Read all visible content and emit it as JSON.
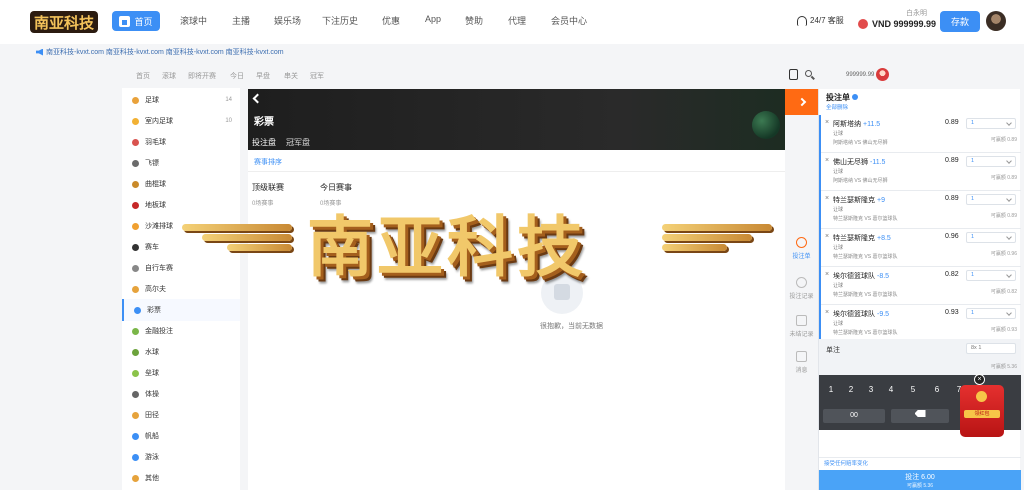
{
  "header": {
    "home_label": "首页",
    "nav": [
      "滚球中",
      "主播",
      "娱乐场",
      "下注历史",
      "优惠",
      "App",
      "赞助",
      "代理",
      "会员中心"
    ],
    "service_label": "24/7 客服",
    "account_name": "白永明",
    "balance": "VND 999999.99",
    "deposit_label": "存款"
  },
  "marquee": "南亚科技-kvxt.com 南亚科技-kvxt.com 南亚科技-kvxt.com 南亚科技-kvxt.com",
  "subnav": {
    "items": [
      "首页",
      "滚球",
      "即将开赛",
      "今日",
      "早盘",
      "串关",
      "冠军"
    ],
    "user_label": "999999.99"
  },
  "sidebar": {
    "items": [
      {
        "label": "足球",
        "count": "14",
        "icon": "soccer-icon",
        "color": "#e9a23b"
      },
      {
        "label": "室内足球",
        "count": "10",
        "icon": "futsal-icon",
        "color": "#f2b134"
      },
      {
        "label": "羽毛球",
        "count": "",
        "icon": "badminton-icon",
        "color": "#d9534f"
      },
      {
        "label": "飞镖",
        "count": "",
        "icon": "darts-icon",
        "color": "#6b6b6b"
      },
      {
        "label": "曲棍球",
        "count": "",
        "icon": "hockey-icon",
        "color": "#c98a2a"
      },
      {
        "label": "地板球",
        "count": "",
        "icon": "floorball-icon",
        "color": "#c62828"
      },
      {
        "label": "沙滩排球",
        "count": "",
        "icon": "beach-volleyball-icon",
        "color": "#f0a030"
      },
      {
        "label": "赛车",
        "count": "",
        "icon": "racing-icon",
        "color": "#333333"
      },
      {
        "label": "自行车赛",
        "count": "",
        "icon": "cycling-icon",
        "color": "#888888"
      },
      {
        "label": "高尔夫",
        "count": "",
        "icon": "golf-icon",
        "color": "#e6a33c"
      },
      {
        "label": "彩票",
        "count": "",
        "icon": "lottery-icon",
        "color": "#3c8ff5",
        "active": true
      },
      {
        "label": "金融投注",
        "count": "",
        "icon": "finance-icon",
        "color": "#7ab648"
      },
      {
        "label": "水球",
        "count": "",
        "icon": "waterpolo-icon",
        "color": "#6ca33c"
      },
      {
        "label": "垒球",
        "count": "",
        "icon": "softball-icon",
        "color": "#8bc34a"
      },
      {
        "label": "体操",
        "count": "",
        "icon": "gymnastics-icon",
        "color": "#666666"
      },
      {
        "label": "田径",
        "count": "",
        "icon": "athletics-icon",
        "color": "#e6a33c"
      },
      {
        "label": "帆船",
        "count": "",
        "icon": "sailing-icon",
        "color": "#3c8ff5"
      },
      {
        "label": "游泳",
        "count": "",
        "icon": "swimming-icon",
        "color": "#3c8ff5"
      },
      {
        "label": "其他",
        "count": "",
        "icon": "other-icon",
        "color": "#e6a33c"
      }
    ]
  },
  "main": {
    "title": "彩票",
    "tabs": [
      "投注盘",
      "冠军盘"
    ],
    "sub_heading": "赛事排序",
    "competitions": [
      {
        "name": "顶级联赛",
        "sub": "0场赛事"
      },
      {
        "name": "今日赛事",
        "sub": "0场赛事"
      }
    ],
    "empty_text": "很抱歉，当前无数据"
  },
  "rail": {
    "items": [
      "投注单",
      "投注记录",
      "未结记录",
      "消息"
    ]
  },
  "slip": {
    "title": "投注单",
    "subtitle": "全部删除",
    "bets": [
      {
        "team": "阿斯塔纳",
        "line": "+11.5",
        "odds": "0.89",
        "market": "让球",
        "match": "阿斯塔纳 VS 佛山无尽狮",
        "max": "可赢额 0.89"
      },
      {
        "team": "佛山无尽狮",
        "line": "-11.5",
        "odds": "0.89",
        "market": "让球",
        "match": "阿斯塔纳 VS 佛山无尽狮",
        "max": "可赢额 0.89"
      },
      {
        "team": "特兰瑟斯隆克",
        "line": "+9",
        "odds": "0.89",
        "market": "让球",
        "match": "特兰瑟斯隆克 VS 葛尔篮球队",
        "max": "可赢额 0.89"
      },
      {
        "team": "特兰瑟斯隆克",
        "line": "+8.5",
        "odds": "0.96",
        "market": "让球",
        "match": "特兰瑟斯隆克 VS 葛尔篮球队",
        "max": "可赢额 0.96"
      },
      {
        "team": "埃尔德篮球队",
        "line": "-8.5",
        "odds": "0.82",
        "market": "让球",
        "match": "特兰瑟斯隆克 VS 葛尔篮球队",
        "max": "可赢额 0.82"
      },
      {
        "team": "埃尔德篮球队",
        "line": "-9.5",
        "odds": "0.93",
        "market": "让球",
        "match": "特兰瑟斯隆克 VS 葛尔篮球队",
        "max": "可赢额 0.93"
      }
    ],
    "stake_placeholder": "1",
    "parlay_label": "单注",
    "parlay_value": "8x 1",
    "parlay_max": "可赢额 5.36",
    "keys": [
      "1",
      "2",
      "3",
      "4",
      "5",
      "6",
      "7",
      "8"
    ],
    "key_max": "00",
    "accept_label": "接受任何赔率变化",
    "place_label": "投注 6.00",
    "place_sub": "可赢额 5.36"
  },
  "promo": {
    "label": "领红包",
    "close": "×"
  },
  "watermark": "南亚科技",
  "colors": {
    "primary": "#3c8ff5",
    "accent": "#ff6a13",
    "dark_hero": "#1e1e1e"
  }
}
